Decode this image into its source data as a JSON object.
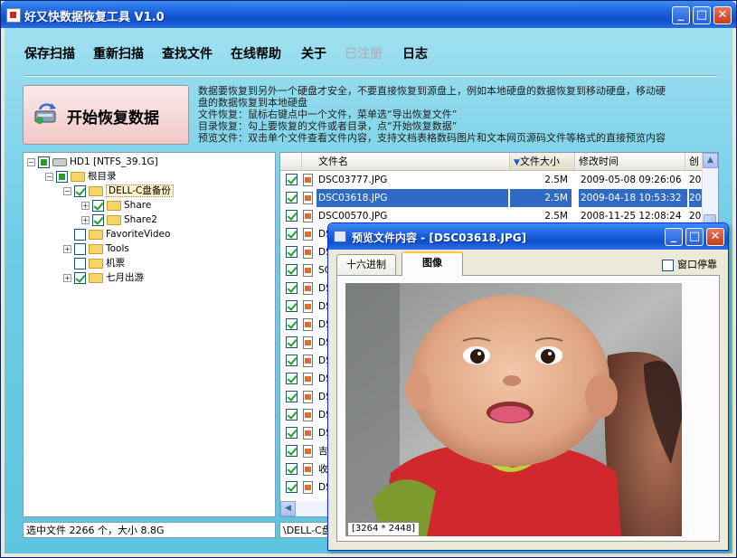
{
  "window": {
    "title": "好又快数据恢复工具 V1.0"
  },
  "menu": [
    "保存扫描",
    "重新扫描",
    "查找文件",
    "在线帮助",
    "关于",
    "已注册",
    "日志"
  ],
  "start_button": {
    "label": "开始恢复数据"
  },
  "info_lines": [
    "数据要恢复到另外一个硬盘才安全，不要直接恢复到源盘上，例如本地硬盘的数据恢复到移动硬盘，移动硬",
    "盘的数据恢复到本地硬盘",
    "文件恢复：鼠标右键点中一个文件，菜单选“导出恢复文件”",
    "目录恢复：勾上要恢复的文件或者目录，点“开始恢复数据”",
    "预览文件：双击单个文件查看文件内容，支持文档表格数码图片和文本网页源码文件等格式的直接预览内容"
  ],
  "tree": {
    "drive": "HD1 [NTFS_39.1G]",
    "root": "根目录",
    "selected_folder": "DELL-C盘备份",
    "children": [
      "Share",
      "Share2"
    ],
    "other": [
      "FavoriteVideo",
      "Tools",
      "机票",
      "七月出游"
    ]
  },
  "list": {
    "headers": {
      "name": "文件名",
      "size": "文件大小",
      "time": "修改时间",
      "created": "创"
    },
    "rows": [
      {
        "name": "DSC03777.JPG",
        "size": "2.5M",
        "time": "2009-05-08 09:26:06",
        "c": "20"
      },
      {
        "name": "DSC03618.JPG",
        "size": "2.5M",
        "time": "2009-04-18 10:53:32",
        "c": "20"
      },
      {
        "name": "DSC00570.JPG",
        "size": "2.5M",
        "time": "2008-11-25 12:08:24",
        "c": "20"
      },
      {
        "name": "DS",
        "size": "",
        "time": "",
        "c": ""
      },
      {
        "name": "DS",
        "size": "",
        "time": "",
        "c": ""
      },
      {
        "name": "SC",
        "size": "",
        "time": "",
        "c": ""
      },
      {
        "name": "DS",
        "size": "",
        "time": "",
        "c": ""
      },
      {
        "name": "DS",
        "size": "",
        "time": "",
        "c": ""
      },
      {
        "name": "DS",
        "size": "",
        "time": "",
        "c": ""
      },
      {
        "name": "DS",
        "size": "",
        "time": "",
        "c": ""
      },
      {
        "name": "DS",
        "size": "",
        "time": "",
        "c": ""
      },
      {
        "name": "DS",
        "size": "",
        "time": "",
        "c": ""
      },
      {
        "name": "DS",
        "size": "",
        "time": "",
        "c": ""
      },
      {
        "name": "DS",
        "size": "",
        "time": "",
        "c": ""
      },
      {
        "name": "DS",
        "size": "",
        "time": "",
        "c": ""
      },
      {
        "name": "吉",
        "size": "",
        "time": "",
        "c": ""
      },
      {
        "name": "收",
        "size": "",
        "time": "",
        "c": ""
      },
      {
        "name": "DS",
        "size": "",
        "time": "",
        "c": ""
      }
    ]
  },
  "status": {
    "left": "选中文件 2266 个，大小 8.8G",
    "right": "\\DELL-C盘"
  },
  "preview": {
    "title": "预览文件内容 - [DSC03618.JPG]",
    "tabs": [
      "十六进制",
      "图像"
    ],
    "dock_label": "窗口停靠",
    "image_size": "[3264 * 2448]"
  }
}
